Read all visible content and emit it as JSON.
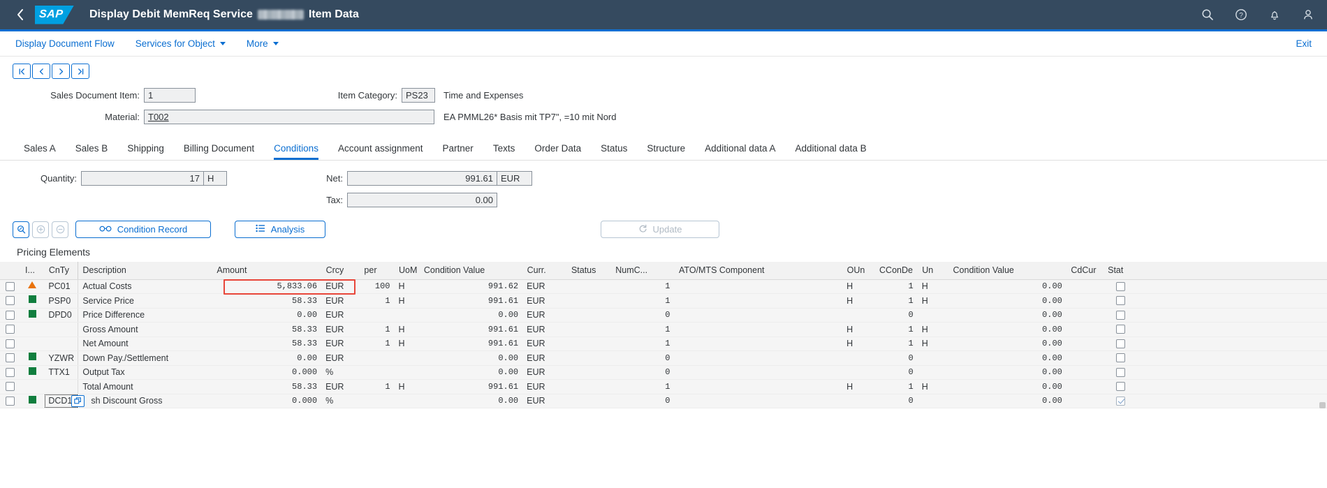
{
  "shell": {
    "back_icon": "chevron-left-icon",
    "logo_text": "SAP",
    "title_prefix": "Display Debit MemReq Service",
    "title_suffix": "Item Data",
    "icons": [
      "search-icon",
      "help-icon",
      "bell-icon",
      "user-avatar-icon"
    ],
    "accent": "#0a6ed1",
    "header_bg": "#354a5f"
  },
  "action_bar": {
    "links": [
      {
        "label": "Display Document Flow",
        "has_caret": false
      },
      {
        "label": "Services for Object",
        "has_caret": true
      },
      {
        "label": "More",
        "has_caret": true
      }
    ],
    "exit_label": "Exit"
  },
  "nav_buttons": [
    {
      "name": "first",
      "glyph": "|‹"
    },
    {
      "name": "previous",
      "glyph": "‹"
    },
    {
      "name": "next",
      "glyph": "›"
    },
    {
      "name": "last",
      "glyph": "›|"
    }
  ],
  "form": {
    "sales_document_item_label": "Sales Document Item:",
    "sales_document_item_value": "1",
    "item_category_label": "Item Category:",
    "item_category_value": "PS23",
    "item_category_desc": "Time and Expenses",
    "material_label": "Material:",
    "material_value": "T002",
    "material_desc": "EA PMML26* Basis mit TP7\", =10 mit Nord"
  },
  "tabs": [
    {
      "label": "Sales A",
      "active": false
    },
    {
      "label": "Sales B",
      "active": false
    },
    {
      "label": "Shipping",
      "active": false
    },
    {
      "label": "Billing Document",
      "active": false
    },
    {
      "label": "Conditions",
      "active": true
    },
    {
      "label": "Account assignment",
      "active": false
    },
    {
      "label": "Partner",
      "active": false
    },
    {
      "label": "Texts",
      "active": false
    },
    {
      "label": "Order Data",
      "active": false
    },
    {
      "label": "Status",
      "active": false
    },
    {
      "label": "Structure",
      "active": false
    },
    {
      "label": "Additional data A",
      "active": false
    },
    {
      "label": "Additional data B",
      "active": false
    }
  ],
  "summary": {
    "quantity_label": "Quantity:",
    "quantity_value": "17",
    "quantity_uom": "H",
    "net_label": "Net:",
    "net_value": "991.61",
    "net_currency": "EUR",
    "tax_label": "Tax:",
    "tax_value": "0.00"
  },
  "toolbar": {
    "search_icon": "magnifier-icon",
    "add_icon": "plus-circle-icon",
    "remove_icon": "minus-circle-icon",
    "condition_record_label": "Condition Record",
    "condition_record_icon": "glasses-icon",
    "analysis_label": "Analysis",
    "analysis_icon": "list-icon",
    "update_label": "Update",
    "update_icon": "refresh-icon",
    "update_disabled": true,
    "settings_icon": "gear-icon"
  },
  "table": {
    "section_title": "Pricing Elements",
    "columns": [
      "",
      "I...",
      "CnTy",
      "Description",
      "Amount",
      "Crcy",
      "per",
      "UoM",
      "Condition Value",
      "Curr.",
      "Status",
      "NumC...",
      "ATO/MTS Component",
      "OUn",
      "CConDe",
      "Un",
      "Condition Value",
      "CdCur",
      "Stat",
      ""
    ],
    "rows": [
      {
        "selected": false,
        "status_icon": "warning-triangle-icon",
        "cnty": "PC01",
        "description": "Actual Costs",
        "amount": "5,833.06",
        "crcy": "EUR",
        "per": "100",
        "uom": "H",
        "condition_value": "991.62",
        "curr": "EUR",
        "status": "",
        "numc": "1",
        "ato_mts": "",
        "oun": "H",
        "cconde": "1",
        "un": "H",
        "condition_value2": "0.00",
        "cdcur": "",
        "stat_checked": false,
        "blue": false
      },
      {
        "selected": false,
        "status_icon": "green-square-icon",
        "cnty": "PSP0",
        "description": "Service Price",
        "amount": "58.33",
        "crcy": "EUR",
        "per": "1",
        "uom": "H",
        "condition_value": "991.61",
        "curr": "EUR",
        "status": "",
        "numc": "1",
        "ato_mts": "",
        "oun": "H",
        "cconde": "1",
        "un": "H",
        "condition_value2": "0.00",
        "cdcur": "",
        "stat_checked": false,
        "blue": true
      },
      {
        "selected": false,
        "status_icon": "green-square-icon",
        "cnty": "DPD0",
        "description": "Price Difference",
        "amount": "0.00",
        "crcy": "EUR",
        "per": "",
        "uom": "",
        "condition_value": "0.00",
        "curr": "EUR",
        "status": "",
        "numc": "0",
        "ato_mts": "",
        "oun": "",
        "cconde": "0",
        "un": "",
        "condition_value2": "0.00",
        "cdcur": "",
        "stat_checked": false,
        "blue": true
      },
      {
        "selected": false,
        "status_icon": "",
        "cnty": "",
        "description": "Gross Amount",
        "amount": "58.33",
        "crcy": "EUR",
        "per": "1",
        "uom": "H",
        "condition_value": "991.61",
        "curr": "EUR",
        "status": "",
        "numc": "1",
        "ato_mts": "",
        "oun": "H",
        "cconde": "1",
        "un": "H",
        "condition_value2": "0.00",
        "cdcur": "",
        "stat_checked": false,
        "blue": true,
        "subtotal": true
      },
      {
        "selected": false,
        "status_icon": "",
        "cnty": "",
        "description": "Net Amount",
        "amount": "58.33",
        "crcy": "EUR",
        "per": "1",
        "uom": "H",
        "condition_value": "991.61",
        "curr": "EUR",
        "status": "",
        "numc": "1",
        "ato_mts": "",
        "oun": "H",
        "cconde": "1",
        "un": "H",
        "condition_value2": "0.00",
        "cdcur": "",
        "stat_checked": false,
        "blue": true,
        "subtotal": true
      },
      {
        "selected": false,
        "status_icon": "green-square-icon",
        "cnty": "YZWR",
        "description": "Down Pay./Settlement",
        "amount": "0.00",
        "crcy": "EUR",
        "per": "",
        "uom": "",
        "condition_value": "0.00",
        "curr": "EUR",
        "status": "",
        "numc": "0",
        "ato_mts": "",
        "oun": "",
        "cconde": "0",
        "un": "",
        "condition_value2": "0.00",
        "cdcur": "",
        "stat_checked": false,
        "blue": true
      },
      {
        "selected": false,
        "status_icon": "green-square-icon",
        "cnty": "TTX1",
        "description": "Output Tax",
        "amount": "0.000",
        "crcy": "%",
        "per": "",
        "uom": "",
        "condition_value": "0.00",
        "curr": "EUR",
        "status": "",
        "numc": "0",
        "ato_mts": "",
        "oun": "",
        "cconde": "0",
        "un": "",
        "condition_value2": "0.00",
        "cdcur": "",
        "stat_checked": false,
        "blue": true
      },
      {
        "selected": false,
        "status_icon": "",
        "cnty": "",
        "description": "Total Amount",
        "amount": "58.33",
        "crcy": "EUR",
        "per": "1",
        "uom": "H",
        "condition_value": "991.61",
        "curr": "EUR",
        "status": "",
        "numc": "1",
        "ato_mts": "",
        "oun": "H",
        "cconde": "1",
        "un": "H",
        "condition_value2": "0.00",
        "cdcur": "",
        "stat_checked": false,
        "blue": true,
        "subtotal": true
      },
      {
        "selected": false,
        "status_icon": "green-square-icon",
        "cnty": "DCD1",
        "description": "sh Discount Gross",
        "amount": "0.000",
        "crcy": "%",
        "per": "",
        "uom": "",
        "condition_value": "0.00",
        "curr": "EUR",
        "status": "",
        "numc": "0",
        "ato_mts": "",
        "oun": "",
        "cconde": "0",
        "un": "",
        "condition_value2": "0.00",
        "cdcur": "",
        "stat_checked": true,
        "blue": false,
        "focused": true,
        "value_help": true
      }
    ],
    "highlight": {
      "color": "#e8463a",
      "target": "amount-crcy-per-uom of row 1"
    }
  }
}
